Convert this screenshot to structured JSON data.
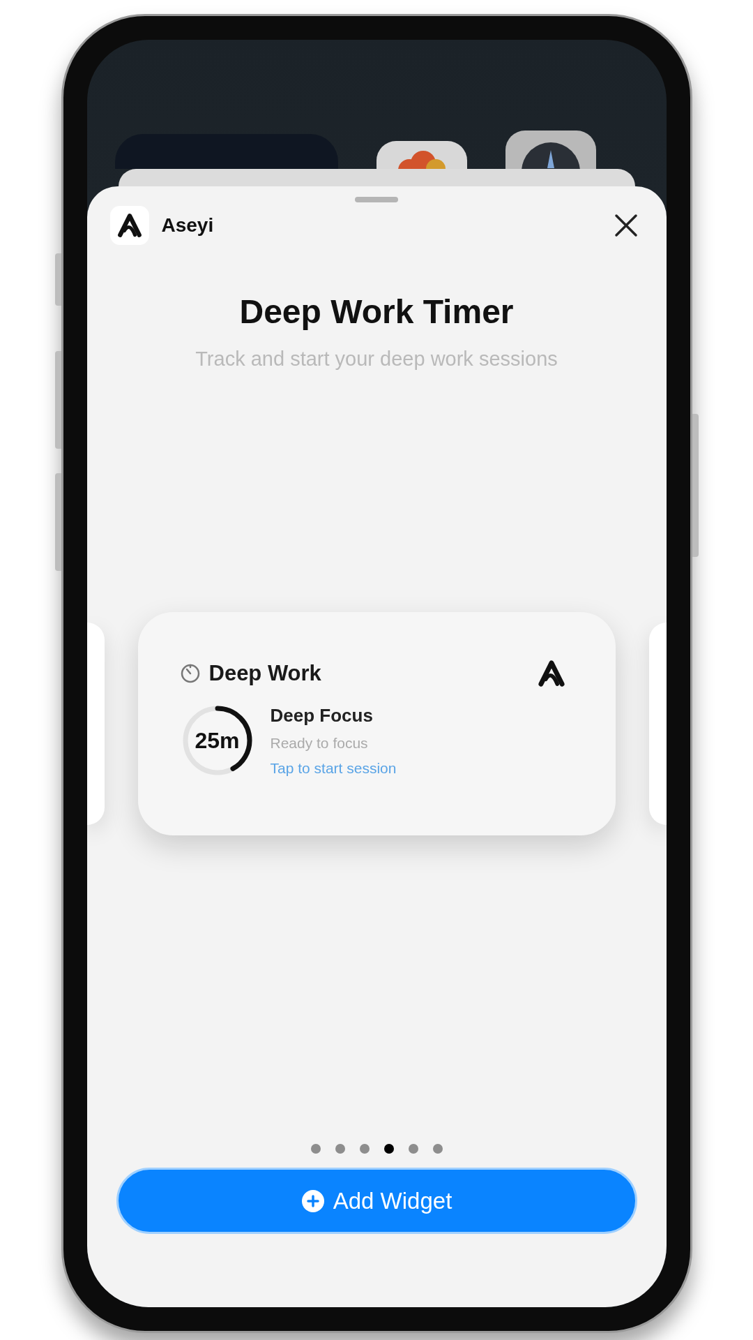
{
  "app": {
    "name": "Aseyi"
  },
  "title": "Deep Work Timer",
  "subtitle": "Track and start your deep work sessions",
  "widget": {
    "title": "Deep Work",
    "timer": "25m",
    "level": 0.42,
    "session": "Deep Focus",
    "status": "Ready to focus",
    "action": "Tap to start session"
  },
  "pages": [
    {
      "selected": false
    },
    {
      "selected": false
    },
    {
      "selected": false
    },
    {
      "selected": true
    },
    {
      "selected": false
    },
    {
      "selected": false
    }
  ],
  "add_button": {
    "label": "Add Widget"
  }
}
